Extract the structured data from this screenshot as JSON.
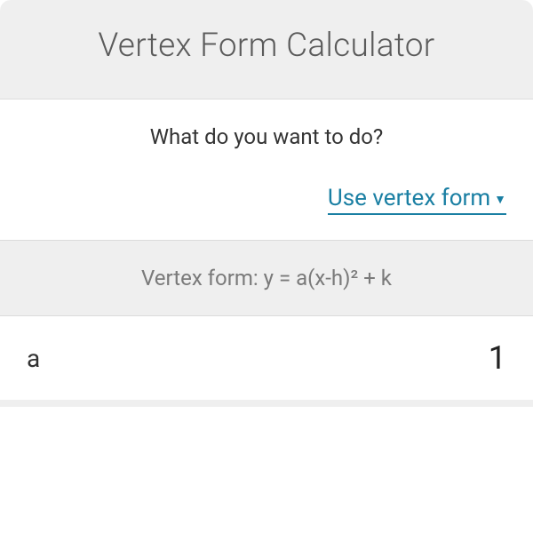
{
  "header": {
    "title": "Vertex Form Calculator"
  },
  "prompt": {
    "question": "What do you want to do?",
    "selected_option": "Use vertex form"
  },
  "formula": {
    "label": "Vertex form: y = a(x-h)² + k"
  },
  "inputs": {
    "a": {
      "label": "a",
      "value": "1"
    }
  }
}
